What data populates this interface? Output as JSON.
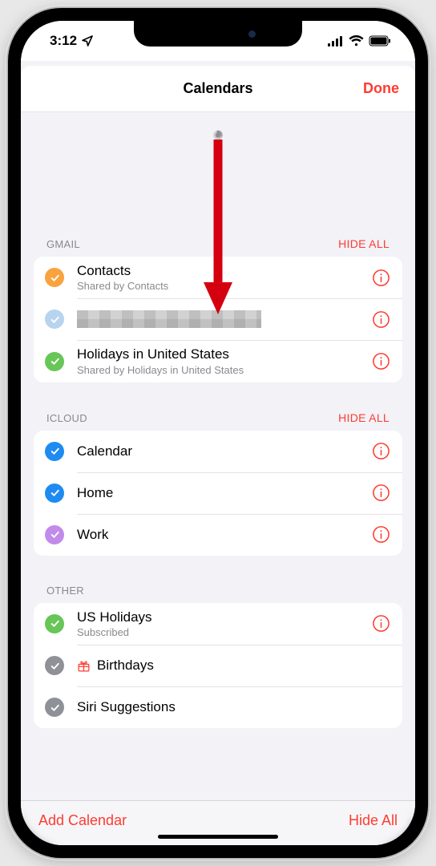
{
  "status": {
    "time": "3:12"
  },
  "header": {
    "title": "Calendars",
    "done": "Done"
  },
  "colors": {
    "accent": "#ff3b30",
    "checks": {
      "amber": "#f8a33d",
      "lightblue": "#b7d4ef",
      "green": "#67c657",
      "blue": "#1e8bf2",
      "purple": "#c18bea",
      "grey": "#8e9197"
    }
  },
  "sections": [
    {
      "label": "GMAIL",
      "action": "HIDE ALL",
      "items": [
        {
          "title": "Contacts",
          "sub": "Shared by Contacts",
          "color": "amber",
          "info": true
        },
        {
          "title": "",
          "sub": "",
          "color": "lightblue",
          "info": true,
          "redacted": true
        },
        {
          "title": "Holidays in United States",
          "sub": "Shared by Holidays in United States",
          "color": "green",
          "info": true
        }
      ]
    },
    {
      "label": "ICLOUD",
      "action": "HIDE ALL",
      "items": [
        {
          "title": "Calendar",
          "color": "blue",
          "info": true
        },
        {
          "title": "Home",
          "color": "blue",
          "info": true
        },
        {
          "title": "Work",
          "color": "purple",
          "info": true
        }
      ]
    },
    {
      "label": "OTHER",
      "action": "",
      "items": [
        {
          "title": "US Holidays",
          "sub": "Subscribed",
          "color": "green",
          "info": true
        },
        {
          "title": "Birthdays",
          "color": "grey",
          "info": false,
          "gift": true
        },
        {
          "title": "Siri Suggestions",
          "color": "grey",
          "info": false
        }
      ]
    }
  ],
  "footer": {
    "left": "Add Calendar",
    "right": "Hide All"
  }
}
